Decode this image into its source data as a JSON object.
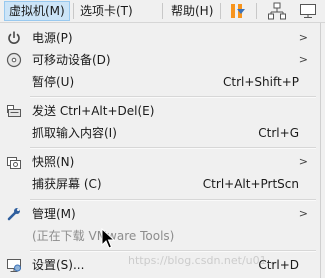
{
  "menubar": {
    "items": [
      {
        "label": "虚拟机(M)",
        "active": true
      },
      {
        "label": "选项卡(T)",
        "active": false
      },
      {
        "label": "帮助(H)",
        "active": false
      }
    ],
    "icons": [
      "pause-icon",
      "dropdown-arrow-icon",
      "network-icon",
      "monitor-icon"
    ]
  },
  "menu": {
    "items": [
      {
        "label": "电源(P)",
        "icon": "power-icon",
        "shortcut": "",
        "submenu": true,
        "enabled": true
      },
      {
        "label": "可移动设备(D)",
        "icon": "disc-icon",
        "shortcut": "",
        "submenu": true,
        "enabled": true
      },
      {
        "label": "暂停(U)",
        "icon": "",
        "shortcut": "Ctrl+Shift+P",
        "submenu": false,
        "enabled": true
      },
      {
        "label": "发送 Ctrl+Alt+Del(E)",
        "icon": "send-keys-icon",
        "shortcut": "",
        "submenu": false,
        "enabled": true
      },
      {
        "label": "抓取输入内容(I)",
        "icon": "",
        "shortcut": "Ctrl+G",
        "submenu": false,
        "enabled": true
      },
      {
        "label": "快照(N)",
        "icon": "snapshot-icon",
        "shortcut": "",
        "submenu": true,
        "enabled": true
      },
      {
        "label": "捕获屏幕 (C)",
        "icon": "",
        "shortcut": "Ctrl+Alt+PrtScn",
        "submenu": false,
        "enabled": true
      },
      {
        "label": "管理(M)",
        "icon": "wrench-icon",
        "shortcut": "",
        "submenu": true,
        "enabled": true
      },
      {
        "label": "(正在下载 VMware Tools)",
        "icon": "",
        "shortcut": "",
        "submenu": false,
        "enabled": false
      },
      {
        "label": "设置(S)...",
        "icon": "settings-icon",
        "shortcut": "Ctrl+D",
        "submenu": false,
        "enabled": true
      }
    ],
    "submenu_glyph": ">"
  },
  "watermark": "https://blog.csdn.net/u01...",
  "colors": {
    "menu_bg": "#f0f0f0",
    "highlight": "#cce4f7",
    "pause_orange": "#f7941d",
    "accent_blue": "#3d73b8",
    "disabled_text": "#8d8d8d"
  }
}
